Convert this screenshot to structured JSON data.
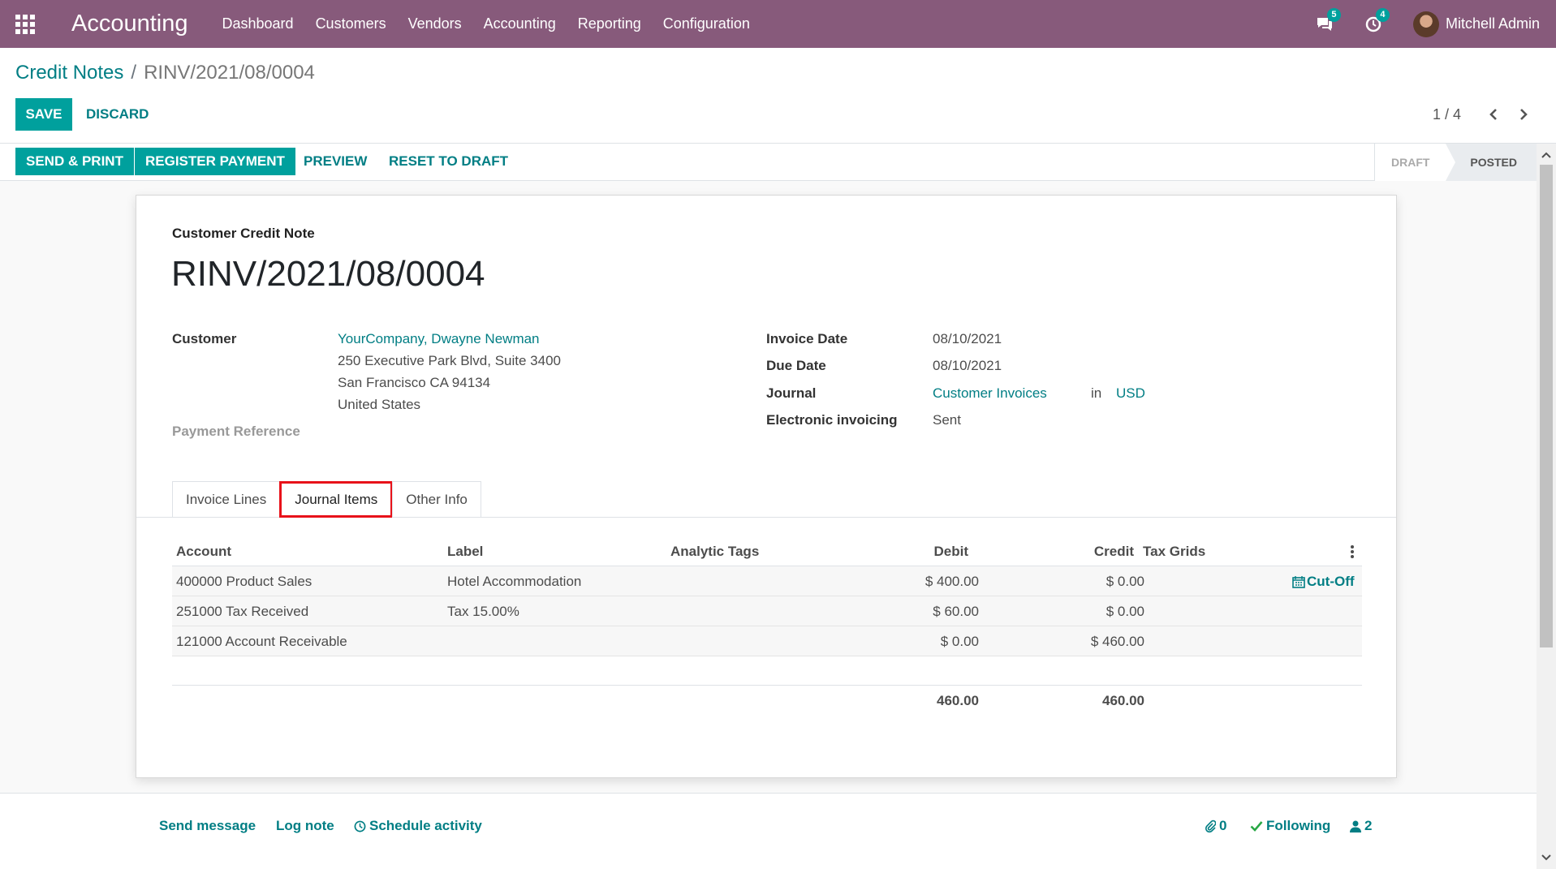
{
  "navbar": {
    "app_title": "Accounting",
    "menu": [
      "Dashboard",
      "Customers",
      "Vendors",
      "Accounting",
      "Reporting",
      "Configuration"
    ],
    "messages_count": "5",
    "activities_count": "4",
    "user_name": "Mitchell Admin"
  },
  "breadcrumb": {
    "parent": "Credit Notes",
    "separator": "/",
    "current": "RINV/2021/08/0004"
  },
  "buttons": {
    "save": "SAVE",
    "discard": "DISCARD"
  },
  "pager": {
    "value": "1 / 4"
  },
  "statusbar": {
    "send_print": "SEND & PRINT",
    "register_payment": "REGISTER PAYMENT",
    "preview": "PREVIEW",
    "reset_to_draft": "RESET TO DRAFT",
    "states": [
      "DRAFT",
      "POSTED"
    ],
    "current_state": "POSTED"
  },
  "document": {
    "type_label": "Customer Credit Note",
    "name": "RINV/2021/08/0004",
    "customer_label": "Customer",
    "customer_name": "YourCompany, Dwayne Newman",
    "address_line1": "250 Executive Park Blvd, Suite 3400",
    "address_line2": "San Francisco CA 94134",
    "address_line3": "United States",
    "payment_reference_label": "Payment Reference",
    "invoice_date_label": "Invoice Date",
    "invoice_date": "08/10/2021",
    "due_date_label": "Due Date",
    "due_date": "08/10/2021",
    "journal_label": "Journal",
    "journal": "Customer Invoices",
    "journal_in": "in",
    "currency": "USD",
    "einvoicing_label": "Electronic invoicing",
    "einvoicing": "Sent"
  },
  "tabs": {
    "invoice_lines": "Invoice Lines",
    "journal_items": "Journal Items",
    "other_info": "Other Info",
    "active": "Journal Items"
  },
  "journal_items": {
    "headers": {
      "account": "Account",
      "label": "Label",
      "analytic_tags": "Analytic Tags",
      "debit": "Debit",
      "credit": "Credit",
      "tax_grids": "Tax Grids"
    },
    "rows": [
      {
        "account": "400000 Product Sales",
        "label": "Hotel Accommodation",
        "debit": "$ 400.00",
        "credit": "$ 0.00",
        "action": "Cut-Off"
      },
      {
        "account": "251000 Tax Received",
        "label": "Tax 15.00%",
        "debit": "$ 60.00",
        "credit": "$ 0.00",
        "action": ""
      },
      {
        "account": "121000 Account Receivable",
        "label": "",
        "debit": "$ 0.00",
        "credit": "$ 460.00",
        "action": ""
      }
    ],
    "total_debit": "460.00",
    "total_credit": "460.00"
  },
  "chatter": {
    "send_message": "Send message",
    "log_note": "Log note",
    "schedule_activity": "Schedule activity",
    "attachments_count": "0",
    "following": "Following",
    "followers_count": "2"
  },
  "colors": {
    "navbar": "#875a7b",
    "primary": "#00a09d",
    "link": "#017e84",
    "highlight": "#e8121a"
  }
}
